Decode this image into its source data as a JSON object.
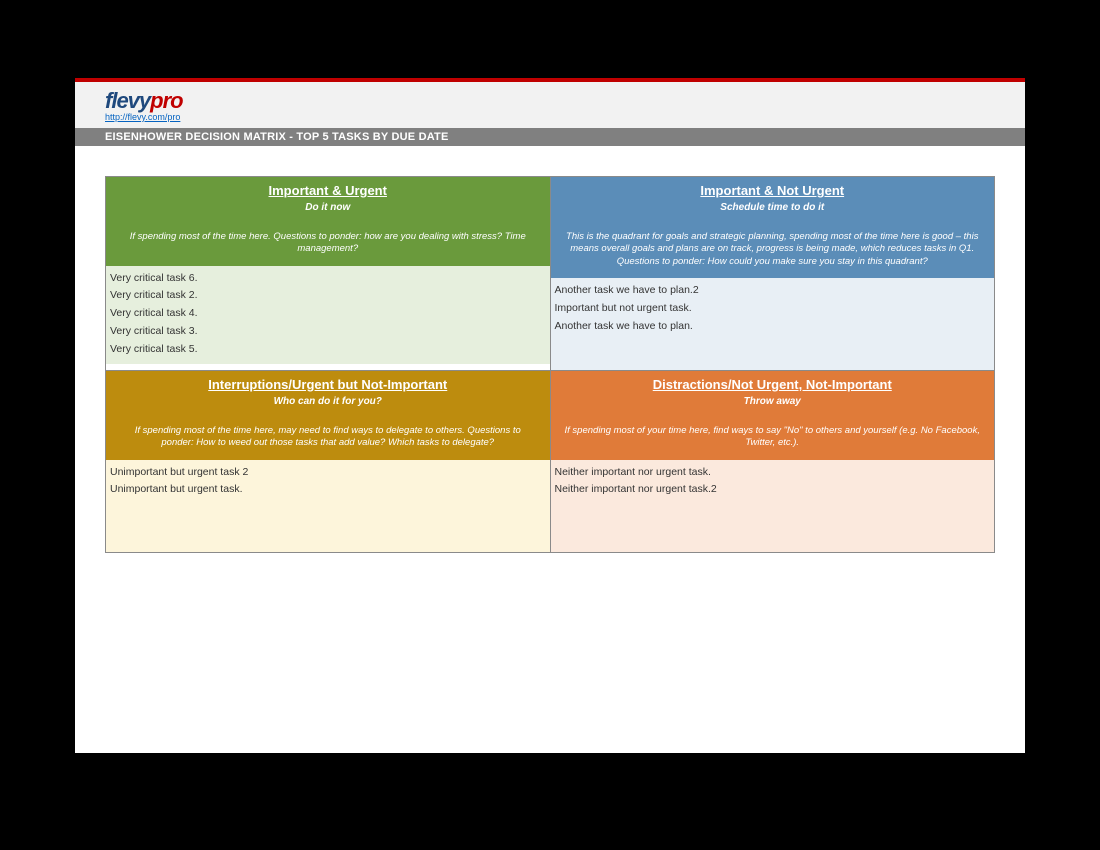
{
  "header": {
    "logo_text_1": "flevy",
    "logo_text_2": "pro",
    "link": "http://flevy.com/pro"
  },
  "title": "EISENHOWER DECISION MATRIX - TOP 5 TASKS BY DUE DATE",
  "quadrants": {
    "q1": {
      "title": "Important & Urgent",
      "action": "Do it now",
      "description": "If spending most of the time here. Questions to ponder: how are you dealing with stress? Time management?",
      "tasks": [
        "Very critical task 6.",
        "Very critical task 2.",
        "Very critical task 4.",
        "Very critical task 3.",
        "Very critical task 5."
      ]
    },
    "q2": {
      "title": "Important & Not Urgent",
      "action": "Schedule time to do it",
      "description": "This is the quadrant for goals and strategic planning, spending most of the time here is good – this means overall goals and plans are on track, progress is being made, which reduces tasks in Q1. Questions to ponder: How could you make sure you stay in this quadrant?",
      "tasks": [
        "Another task we have to plan.2",
        "Important but not urgent task.",
        "Another task we have to plan."
      ]
    },
    "q3": {
      "title": "Interruptions/Urgent but Not-Important",
      "action": "Who can do it for you?",
      "description": "If spending most of the time here, may need to find ways to delegate to others. Questions to ponder: How to weed out those tasks that add value? Which tasks to delegate?",
      "tasks": [
        "Unimportant but urgent task 2",
        "Unimportant but urgent task."
      ]
    },
    "q4": {
      "title": "Distractions/Not Urgent, Not-Important",
      "action": "Throw away",
      "description": "If spending most of your time here, find ways to say \"No\" to others and yourself (e.g. No Facebook, Twitter, etc.).",
      "tasks": [
        "Neither important nor urgent task.",
        "Neither important nor urgent task.2"
      ]
    }
  }
}
